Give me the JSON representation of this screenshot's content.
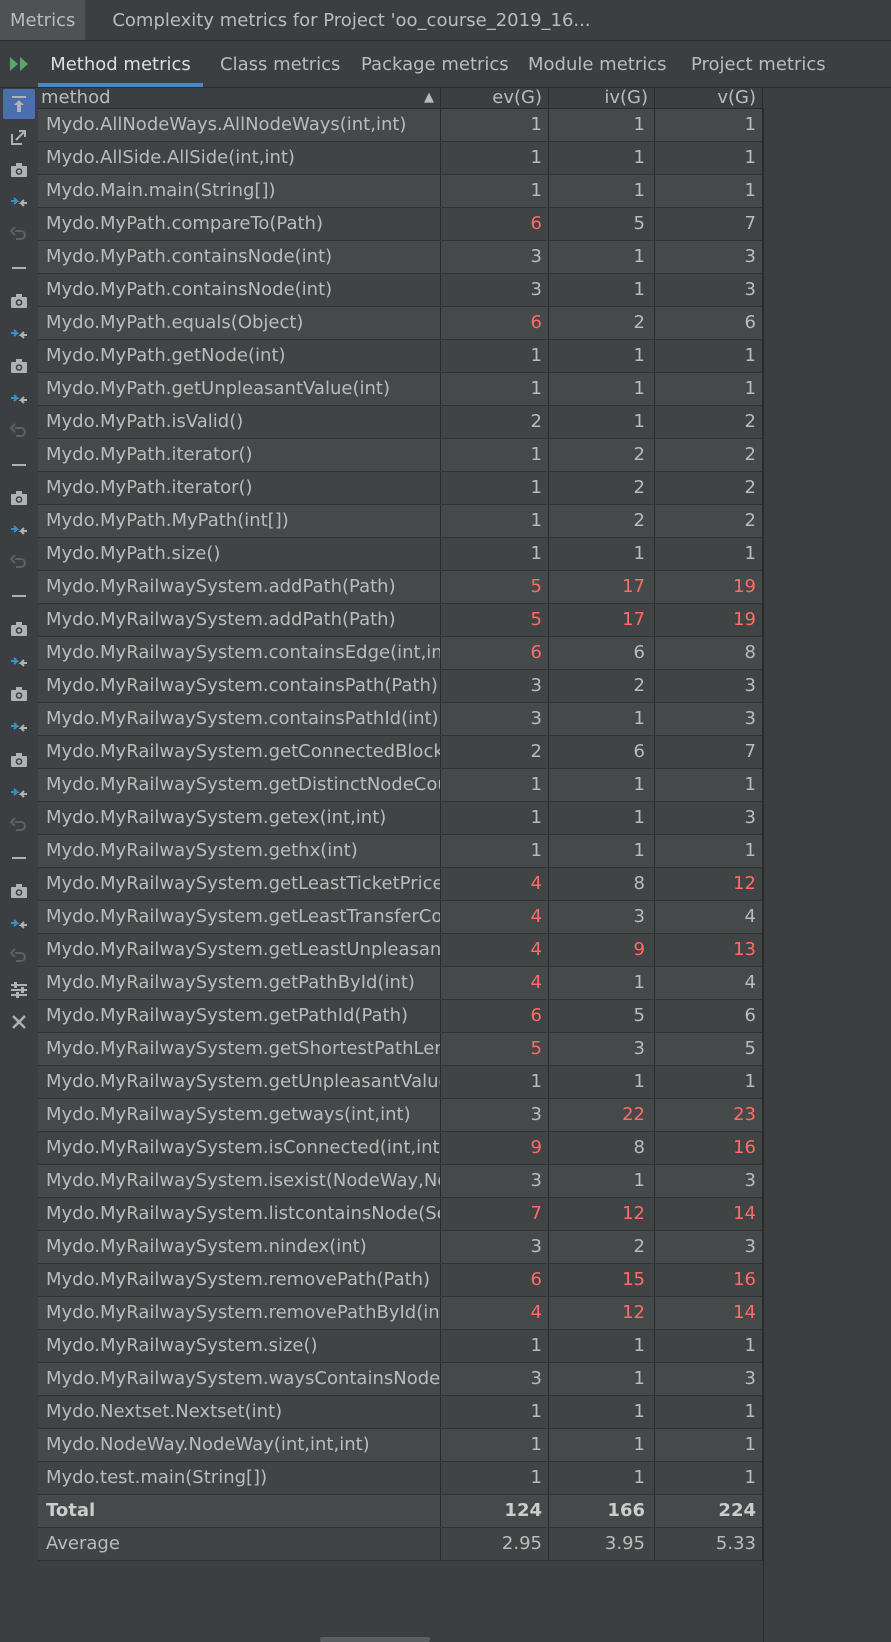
{
  "titlebar": {
    "tabs": [
      {
        "label": "Metrics"
      },
      {
        "label": "Complexity metrics for Project 'oo_course_2019_16..."
      }
    ]
  },
  "tabbar": {
    "tabs": [
      {
        "label": "Method metrics",
        "active": true
      },
      {
        "label": "Class metrics"
      },
      {
        "label": "Package metrics"
      },
      {
        "label": "Module metrics"
      },
      {
        "label": "Project metrics"
      }
    ]
  },
  "sidebar": {
    "icons": [
      "pin-icon",
      "export-icon",
      "camera-icon",
      "diff-icon",
      "undo-icon",
      "minus-icon",
      "camera-icon",
      "diff-icon",
      "camera-icon",
      "diff-icon",
      "undo-icon",
      "minus-icon",
      "camera-icon",
      "diff-icon",
      "undo-icon",
      "minus-icon",
      "camera-icon",
      "diff-icon",
      "camera-icon",
      "diff-icon",
      "camera-icon",
      "diff-icon",
      "undo-icon",
      "minus-icon",
      "camera-icon",
      "diff-icon",
      "undo-icon",
      "settings-icon",
      "close-icon"
    ]
  },
  "table": {
    "headers": {
      "method": "method",
      "ev": "ev(G)",
      "iv": "iv(G)",
      "v": "v(G)"
    },
    "sort_indicator": "▲",
    "rows": [
      {
        "method": "Mydo.AllNodeWays.AllNodeWays(int,int)",
        "ev": "1",
        "iv": "1",
        "v": "1"
      },
      {
        "method": "Mydo.AllSide.AllSide(int,int)",
        "ev": "1",
        "iv": "1",
        "v": "1"
      },
      {
        "method": "Mydo.Main.main(String[])",
        "ev": "1",
        "iv": "1",
        "v": "1"
      },
      {
        "method": "Mydo.MyPath.compareTo(Path)",
        "ev": "6",
        "iv": "5",
        "v": "7",
        "red": [
          "ev"
        ]
      },
      {
        "method": "Mydo.MyPath.containsNode(int)",
        "ev": "3",
        "iv": "1",
        "v": "3"
      },
      {
        "method": "Mydo.MyPath.containsNode(int)",
        "ev": "3",
        "iv": "1",
        "v": "3"
      },
      {
        "method": "Mydo.MyPath.equals(Object)",
        "ev": "6",
        "iv": "2",
        "v": "6",
        "red": [
          "ev"
        ]
      },
      {
        "method": "Mydo.MyPath.getNode(int)",
        "ev": "1",
        "iv": "1",
        "v": "1"
      },
      {
        "method": "Mydo.MyPath.getUnpleasantValue(int)",
        "ev": "1",
        "iv": "1",
        "v": "1"
      },
      {
        "method": "Mydo.MyPath.isValid()",
        "ev": "2",
        "iv": "1",
        "v": "2"
      },
      {
        "method": "Mydo.MyPath.iterator()",
        "ev": "1",
        "iv": "2",
        "v": "2"
      },
      {
        "method": "Mydo.MyPath.iterator()",
        "ev": "1",
        "iv": "2",
        "v": "2"
      },
      {
        "method": "Mydo.MyPath.MyPath(int[])",
        "ev": "1",
        "iv": "2",
        "v": "2"
      },
      {
        "method": "Mydo.MyPath.size()",
        "ev": "1",
        "iv": "1",
        "v": "1"
      },
      {
        "method": "Mydo.MyRailwaySystem.addPath(Path)",
        "ev": "5",
        "iv": "17",
        "v": "19",
        "red": [
          "ev",
          "iv",
          "v"
        ]
      },
      {
        "method": "Mydo.MyRailwaySystem.addPath(Path)",
        "ev": "5",
        "iv": "17",
        "v": "19",
        "red": [
          "ev",
          "iv",
          "v"
        ]
      },
      {
        "method": "Mydo.MyRailwaySystem.containsEdge(int,int)",
        "ev": "6",
        "iv": "6",
        "v": "8",
        "red": [
          "ev"
        ]
      },
      {
        "method": "Mydo.MyRailwaySystem.containsPath(Path)",
        "ev": "3",
        "iv": "2",
        "v": "3"
      },
      {
        "method": "Mydo.MyRailwaySystem.containsPathId(int)",
        "ev": "3",
        "iv": "1",
        "v": "3"
      },
      {
        "method": "Mydo.MyRailwaySystem.getConnectedBlockCou",
        "ev": "2",
        "iv": "6",
        "v": "7"
      },
      {
        "method": "Mydo.MyRailwaySystem.getDistinctNodeCount(",
        "ev": "1",
        "iv": "1",
        "v": "1"
      },
      {
        "method": "Mydo.MyRailwaySystem.getex(int,int)",
        "ev": "1",
        "iv": "1",
        "v": "3"
      },
      {
        "method": "Mydo.MyRailwaySystem.gethx(int)",
        "ev": "1",
        "iv": "1",
        "v": "1"
      },
      {
        "method": "Mydo.MyRailwaySystem.getLeastTicketPrice(int,",
        "ev": "4",
        "iv": "8",
        "v": "12",
        "red": [
          "ev",
          "v"
        ]
      },
      {
        "method": "Mydo.MyRailwaySystem.getLeastTransferCount(",
        "ev": "4",
        "iv": "3",
        "v": "4",
        "red": [
          "ev"
        ]
      },
      {
        "method": "Mydo.MyRailwaySystem.getLeastUnpleasantVal",
        "ev": "4",
        "iv": "9",
        "v": "13",
        "red": [
          "ev",
          "iv",
          "v"
        ]
      },
      {
        "method": "Mydo.MyRailwaySystem.getPathById(int)",
        "ev": "4",
        "iv": "1",
        "v": "4",
        "red": [
          "ev"
        ]
      },
      {
        "method": "Mydo.MyRailwaySystem.getPathId(Path)",
        "ev": "6",
        "iv": "5",
        "v": "6",
        "red": [
          "ev"
        ]
      },
      {
        "method": "Mydo.MyRailwaySystem.getShortestPathLength",
        "ev": "5",
        "iv": "3",
        "v": "5",
        "red": [
          "ev"
        ]
      },
      {
        "method": "Mydo.MyRailwaySystem.getUnpleasantValue(Pa",
        "ev": "1",
        "iv": "1",
        "v": "1"
      },
      {
        "method": "Mydo.MyRailwaySystem.getways(int,int)",
        "ev": "3",
        "iv": "22",
        "v": "23",
        "red": [
          "iv",
          "v"
        ]
      },
      {
        "method": "Mydo.MyRailwaySystem.isConnected(int,int)",
        "ev": "9",
        "iv": "8",
        "v": "16",
        "red": [
          "ev",
          "v"
        ]
      },
      {
        "method": "Mydo.MyRailwaySystem.isexist(NodeWay,Node",
        "ev": "3",
        "iv": "1",
        "v": "3"
      },
      {
        "method": "Mydo.MyRailwaySystem.listcontainsNode(Set<I",
        "ev": "7",
        "iv": "12",
        "v": "14",
        "red": [
          "ev",
          "iv",
          "v"
        ]
      },
      {
        "method": "Mydo.MyRailwaySystem.nindex(int)",
        "ev": "3",
        "iv": "2",
        "v": "3"
      },
      {
        "method": "Mydo.MyRailwaySystem.removePath(Path)",
        "ev": "6",
        "iv": "15",
        "v": "16",
        "red": [
          "ev",
          "iv",
          "v"
        ]
      },
      {
        "method": "Mydo.MyRailwaySystem.removePathById(int)",
        "ev": "4",
        "iv": "12",
        "v": "14",
        "red": [
          "ev",
          "iv",
          "v"
        ]
      },
      {
        "method": "Mydo.MyRailwaySystem.size()",
        "ev": "1",
        "iv": "1",
        "v": "1"
      },
      {
        "method": "Mydo.MyRailwaySystem.waysContainsNode(int,",
        "ev": "3",
        "iv": "1",
        "v": "3"
      },
      {
        "method": "Mydo.Nextset.Nextset(int)",
        "ev": "1",
        "iv": "1",
        "v": "1"
      },
      {
        "method": "Mydo.NodeWay.NodeWay(int,int,int)",
        "ev": "1",
        "iv": "1",
        "v": "1"
      },
      {
        "method": "Mydo.test.main(String[])",
        "ev": "1",
        "iv": "1",
        "v": "1"
      }
    ],
    "total": {
      "label": "Total",
      "ev": "124",
      "iv": "166",
      "v": "224"
    },
    "average": {
      "label": "Average",
      "ev": "2.95",
      "iv": "3.95",
      "v": "5.33"
    }
  },
  "colors": {
    "accent": "#4a88c7",
    "warning": "#ff6b68",
    "run": "#59a869"
  }
}
